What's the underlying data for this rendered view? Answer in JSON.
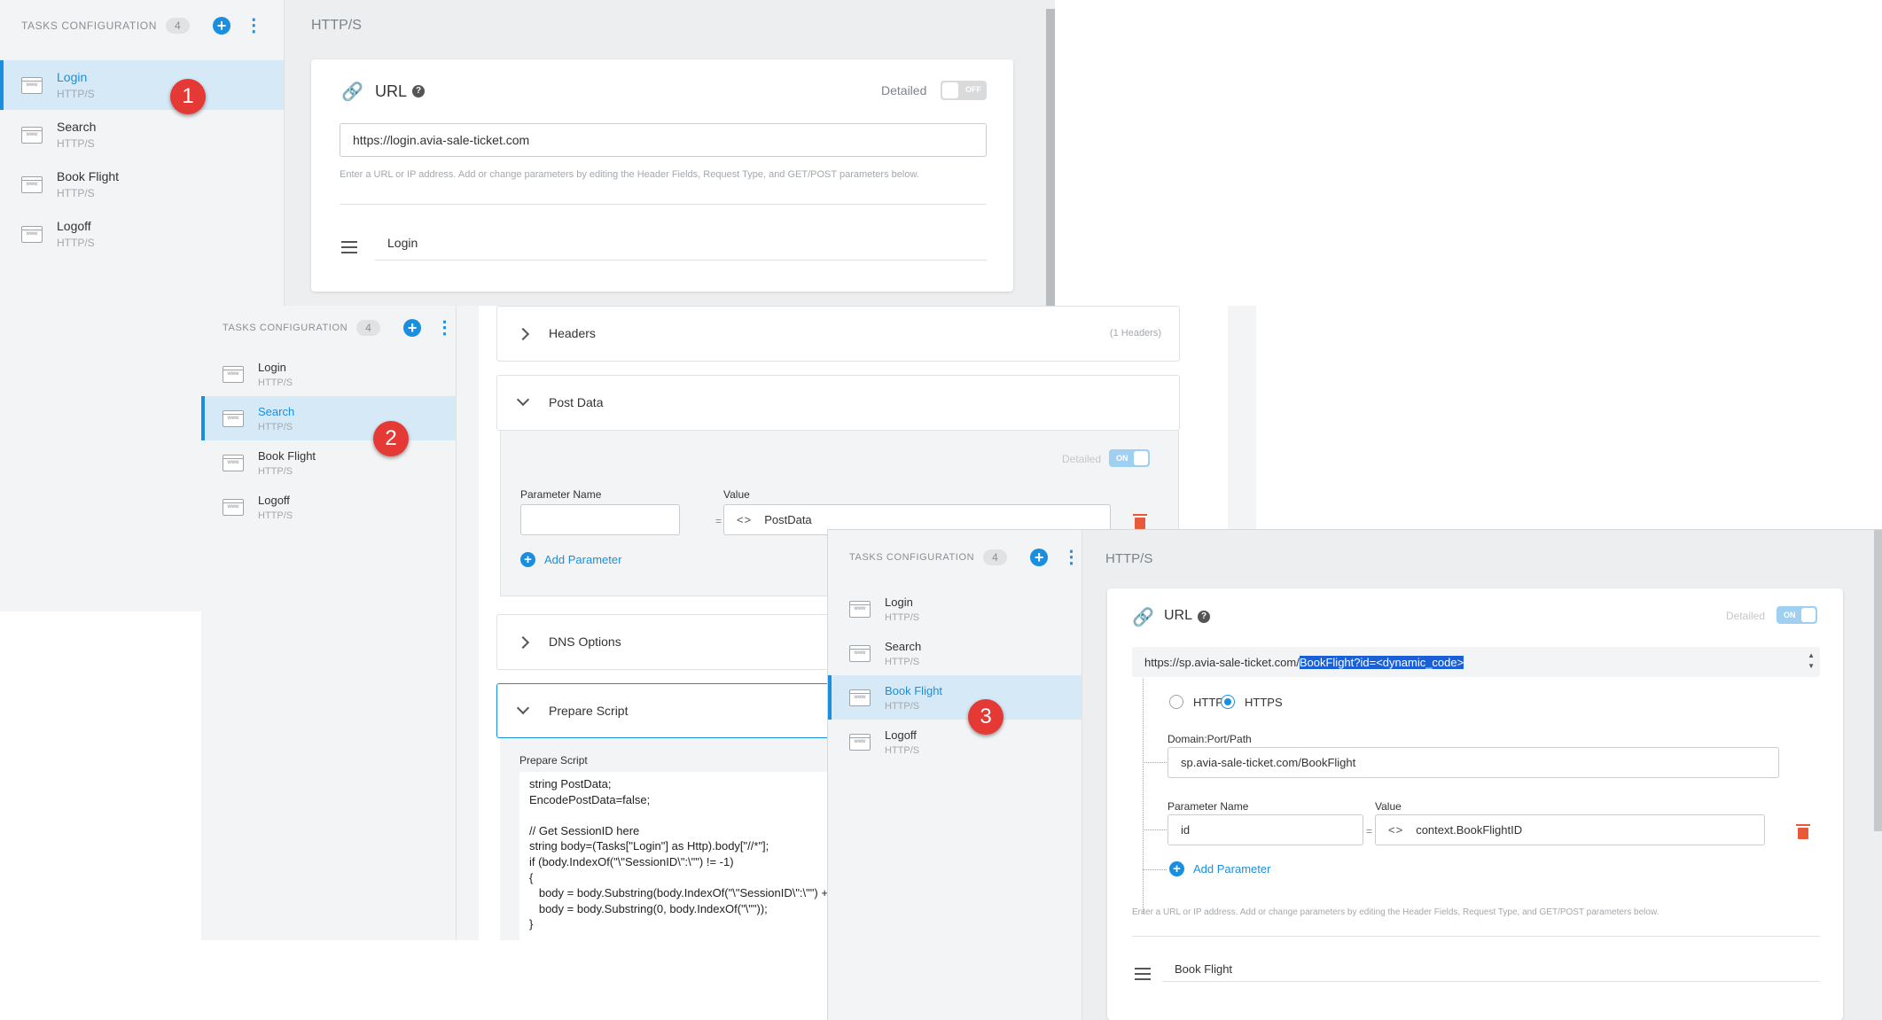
{
  "tasks_header": {
    "label": "TASKS CONFIGURATION",
    "count": "4"
  },
  "tasks": [
    {
      "name": "Login",
      "type": "HTTP/S"
    },
    {
      "name": "Search",
      "type": "HTTP/S"
    },
    {
      "name": "Book Flight",
      "type": "HTTP/S"
    },
    {
      "name": "Logoff",
      "type": "HTTP/S"
    }
  ],
  "panel1": {
    "page_title": "HTTP/S",
    "url_label": "URL",
    "detailed_label": "Detailed",
    "toggle_label": "OFF",
    "url_value": "https://login.avia-sale-ticket.com",
    "hint": "Enter a URL or IP address. Add or change parameters by editing the Header Fields, Request Type, and GET/POST parameters below.",
    "description": "Login",
    "marker": "1"
  },
  "panel2": {
    "headers_title": "Headers",
    "headers_count": "(1 Headers)",
    "post_data_title": "Post Data",
    "detailed_label": "Detailed",
    "toggle_label": "ON",
    "param_name_label": "Parameter Name",
    "value_label": "Value",
    "equals": "=",
    "post_value": "PostData",
    "add_param": "Add Parameter",
    "dns_title": "DNS Options",
    "prepare_title": "Prepare Script",
    "prepare_label": "Prepare Script",
    "script": [
      "string PostData;",
      "EncodePostData=false;",
      "",
      "// Get SessionID here",
      "string body=(Tasks[\"Login\"] as Http).body[\"//*\"];",
      "if (body.IndexOf(\"\\\"SessionID\\\":\\\"\") != -1)",
      "{",
      "   body = body.Substring(body.IndexOf(\"\\\"SessionID\\\":\\\"\") +",
      "   body = body.Substring(0, body.IndexOf(\"\\\"\"));",
      "}"
    ],
    "marker": "2"
  },
  "panel3": {
    "page_title": "HTTP/S",
    "url_label": "URL",
    "detailed_label": "Detailed",
    "toggle_label": "ON",
    "url_prefix": "https://sp.avia-sale-ticket.com/",
    "url_selected": "BookFlight?id=<dynamic_code>",
    "http_label": "HTTP",
    "https_label": "HTTPS",
    "domain_label": "Domain:Port/Path",
    "domain_value": "sp.avia-sale-ticket.com/BookFlight",
    "param_name_label": "Parameter Name",
    "value_label": "Value",
    "param_name_value": "id",
    "equals": "=",
    "param_value": "context.BookFlightID",
    "add_param": "Add Parameter",
    "hint": "Enter a URL or IP address. Add or change parameters by editing the Header Fields, Request Type, and GET/POST parameters below.",
    "description": "Book Flight",
    "marker": "3"
  },
  "colors": {
    "accent": "#1a8fe0",
    "marker": "#e53935",
    "danger": "#e8593a"
  }
}
